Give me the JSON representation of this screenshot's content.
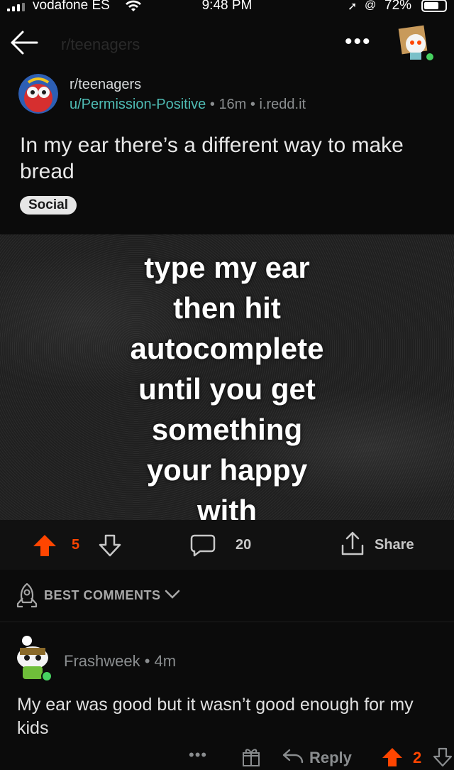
{
  "status_bar": {
    "carrier": "vodafone ES",
    "time": "9:48 PM",
    "battery": "72%"
  },
  "nav": {
    "title": "r/teenagers"
  },
  "post": {
    "subreddit": "r/teenagers",
    "author": "u/Permission-Positive",
    "age": "16m",
    "domain": "i.redd.it",
    "sep1": "•",
    "sep2": "•",
    "title": "In my ear there’s a different way to make bread",
    "flair": "Social",
    "image_text": "type my ear\nthen hit\nautocomplete\nuntil you get\nsomething\nyour happy\nwith",
    "score": "5",
    "comments": "20",
    "share": "Share"
  },
  "sort": {
    "label": "BEST COMMENTS"
  },
  "comment": {
    "author": "Frashweek",
    "sep": "•",
    "age": "4m",
    "text": "My ear was good but it wasn’t good enough for my kids",
    "reply": "Reply",
    "score": "2"
  },
  "colors": {
    "upvote": "#ff4500",
    "username": "#4fbcb4",
    "background": "#0b0b0b"
  }
}
